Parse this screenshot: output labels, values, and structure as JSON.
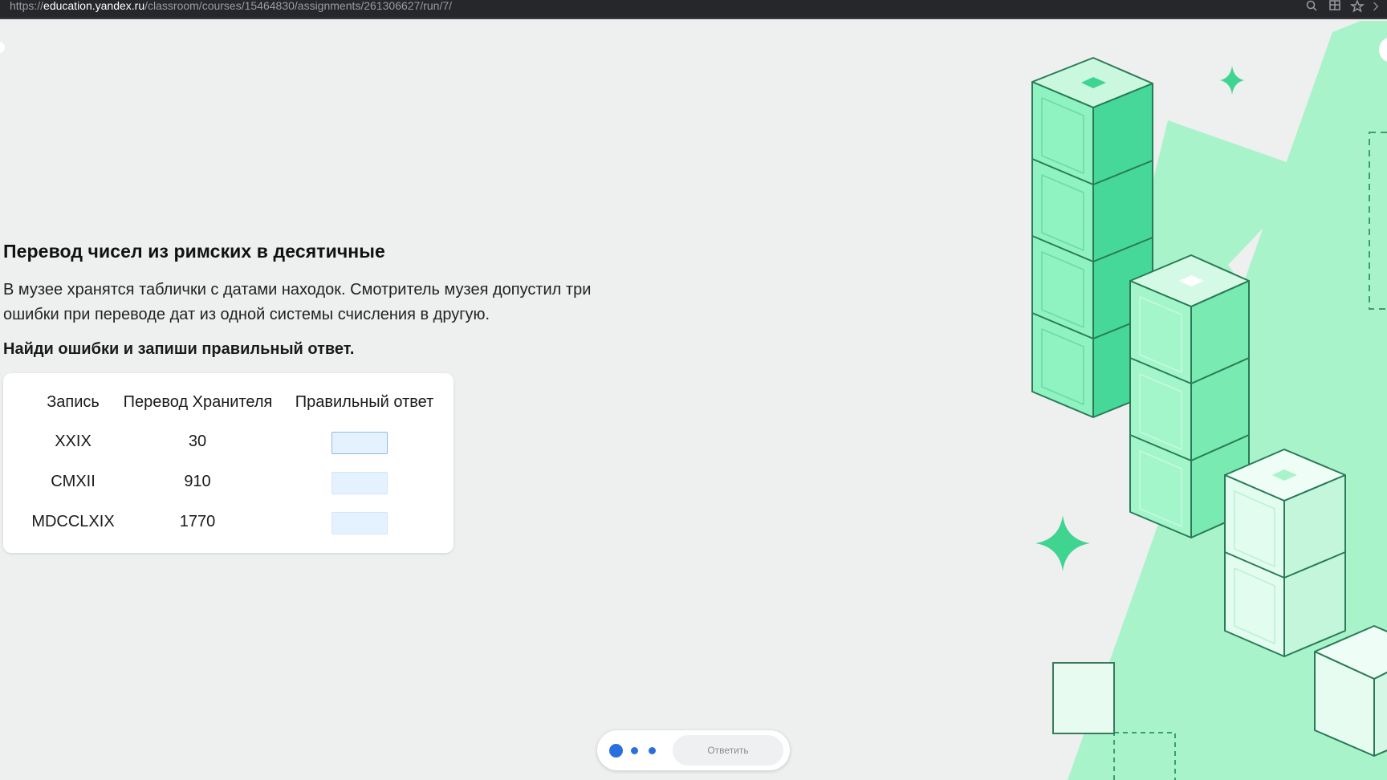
{
  "browser": {
    "url_prefix": "https://",
    "url_domain": "education.yandex.ru",
    "url_path": "/classroom/courses/15464830/assignments/261306627/run/7/"
  },
  "task": {
    "title": "Перевод чисел из римских в десятичные",
    "description": "В музее хранятся таблички с датами находок. Смотритель музея допустил три ошибки при переводе дат из одной системы счисления в другую.",
    "instruction": "Найди ошибки и запиши правильный ответ."
  },
  "table": {
    "headers": [
      "Запись",
      "Перевод Хранителя",
      "Правильный ответ"
    ],
    "rows": [
      {
        "record": "XXIX",
        "keeper": "30",
        "answer": ""
      },
      {
        "record": "CMXII",
        "keeper": "910",
        "answer": ""
      },
      {
        "record": "MDCCLXIX",
        "keeper": "1770",
        "answer": ""
      }
    ]
  },
  "controls": {
    "answer_button_label": "Ответить",
    "pages_total": 3,
    "current_page": 1
  },
  "colors": {
    "accent": "#2a6fe0",
    "green_dark": "#3fd48f",
    "green_light": "#a9f3cb",
    "background": "#eef0ef"
  }
}
